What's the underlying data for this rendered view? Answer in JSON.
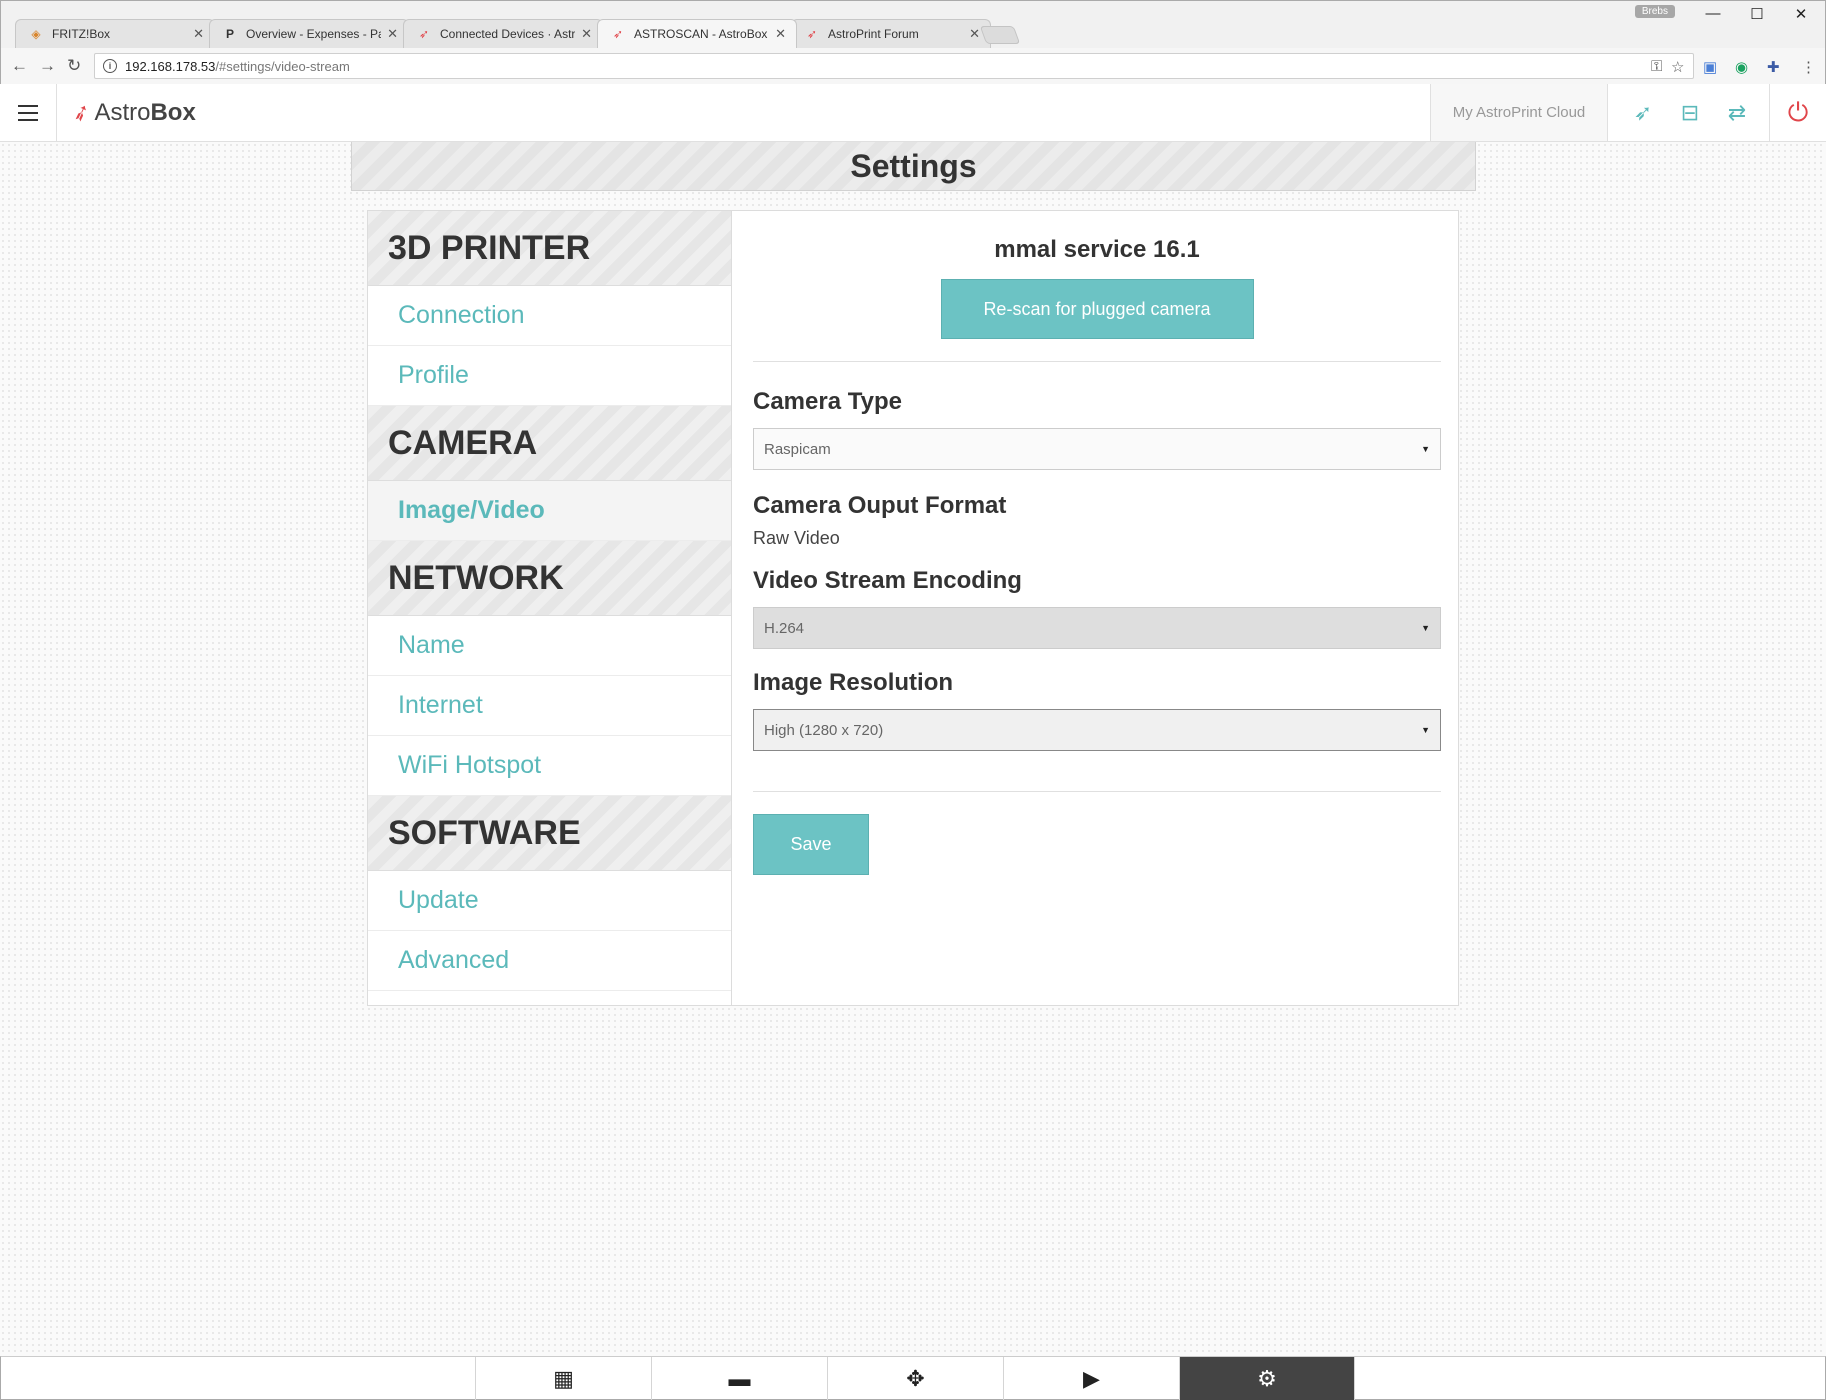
{
  "browser": {
    "tabs": [
      {
        "title": "FRITZ!Box",
        "icon": "fritzbox-icon",
        "icon_color": "#d9852b"
      },
      {
        "title": "Overview - Expenses - Pa",
        "icon": "p-icon",
        "icon_color": "#222222"
      },
      {
        "title": "Connected Devices · Astr",
        "icon": "rocket-icon",
        "icon_color": "#e0454a"
      },
      {
        "title": "ASTROSCAN - AstroBox",
        "icon": "rocket-icon",
        "icon_color": "#e0454a"
      },
      {
        "title": "AstroPrint Forum",
        "icon": "rocket-icon",
        "icon_color": "#e0454a"
      }
    ],
    "active_tab": 3,
    "profile_badge": "Brebs",
    "url_host": "192.168.178.53",
    "url_path": "/#settings/video-stream"
  },
  "app": {
    "logo_normal": "Astro",
    "logo_bold": "Box",
    "cloud_label": "My AstroPrint Cloud",
    "accent_color": "#6cc3c4",
    "power_color": "#e0454a"
  },
  "page_title": "Settings",
  "sidebar": {
    "printer": {
      "heading": "3D PRINTER",
      "items": [
        "Connection",
        "Profile"
      ]
    },
    "camera": {
      "heading": "CAMERA",
      "items": [
        "Image/Video"
      ]
    },
    "network": {
      "heading": "NETWORK",
      "items": [
        "Name",
        "Internet",
        "WiFi Hotspot"
      ]
    },
    "software": {
      "heading": "SOFTWARE",
      "items": [
        "Update",
        "Advanced"
      ]
    }
  },
  "camera": {
    "name": "mmal service 16.1",
    "rescan_label": "Re-scan for plugged camera",
    "type_label": "Camera Type",
    "type_value": "Raspicam",
    "format_label": "Camera Ouput Format",
    "format_value": "Raw Video",
    "encoding_label": "Video Stream Encoding",
    "encoding_value": "H.264",
    "resolution_label": "Image Resolution",
    "resolution_value": "High (1280 x 720)",
    "save_label": "Save"
  },
  "bottom_nav": [
    "grid-icon",
    "folder-icon",
    "move-icon",
    "video-camera-icon",
    "gear-icon"
  ],
  "bottom_nav_active": 4
}
